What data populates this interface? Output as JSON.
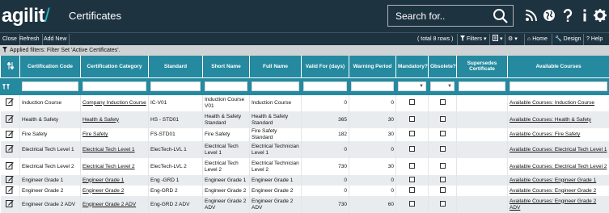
{
  "app": {
    "logo_text": "agilit",
    "logo_slash": "/",
    "page_title": "Certificates",
    "search_placeholder": "Search for.."
  },
  "toolbar": {
    "close": "Close",
    "refresh": "Refresh",
    "add_new": "Add New",
    "total": "( total 8 rows )",
    "filters": "Filters",
    "home": "Home",
    "design": "Design",
    "help": "Help"
  },
  "filter_info": "Applied filters: Filter Set 'Active Certificates'.",
  "table": {
    "headers": [
      "Certification Code",
      "Certification Category",
      "Standard",
      "Short Name",
      "Full Name",
      "Valid For (days)",
      "Warning Period",
      "Mandatory?",
      "Obsolete?",
      "Supersedes Certificate",
      "Available Courses"
    ],
    "rows": [
      {
        "code": "Induction Course",
        "category": "Company Induction Course",
        "standard": "IC-V01",
        "short": "Induction Course V01",
        "full": "Induction Course",
        "valid": "0",
        "warning": "0",
        "courses": "Available Courses: Induction Course"
      },
      {
        "code": "Health & Safety",
        "category": "Health & Safety",
        "standard": "HS - STD01",
        "short": "Health & Safety Standard",
        "full": "Health & Safety Standard",
        "valid": "365",
        "warning": "30",
        "courses": "Available Courses: Health & Safety"
      },
      {
        "code": "Fire Safety",
        "category": "Fire Safety",
        "standard": "FS-STD01",
        "short": "Fire Safety",
        "full": "Fire Safety Standard",
        "valid": "182",
        "warning": "30",
        "courses": "Available Courses: Fire Safety"
      },
      {
        "code": "Electrical Tech Level 1",
        "category": "Electrical Tech Level 1",
        "standard": "ElecTech-LVL 1",
        "short": "Electrical Tech Level 1",
        "full": "Electrical Technician Level 1",
        "valid": "0",
        "warning": "0",
        "courses": "Available Courses: Electrical Tech Level 1"
      },
      {
        "code": "Electrical Tech Level 2",
        "category": "Electrical Tech Level 2",
        "standard": "ElecTech-LVL 2",
        "short": "Electrical Tech Level 2",
        "full": "Electrical Technician Level 2",
        "valid": "730",
        "warning": "30",
        "courses": "Available Courses: Electrical Tech Level 2"
      },
      {
        "code": "Engineer Grade 1",
        "category": "Engineer Grade 1",
        "standard": "Eng -GRD 1",
        "short": "Engineer Grade 1",
        "full": "Engineer Grade 1",
        "valid": "0",
        "warning": "0",
        "courses": "Available Courses: Engineer Grade 1"
      },
      {
        "code": "Engineer Grade 2",
        "category": "Engineer Grade 2",
        "standard": "Eng-GRD 2",
        "short": "Engineer Grade 2",
        "full": "Engineer Grade 2",
        "valid": "0",
        "warning": "0",
        "courses": "Available Courses: Engineer Grade 2"
      },
      {
        "code": "Engineer Grade 2 ADV",
        "category": "Engineer Grade 2 ADV",
        "standard": "Eng-GRD 2 ADV",
        "short": "Engineer Grade 2 ADV",
        "full": "Engineer Grade 2 ADV",
        "valid": "730",
        "warning": "60",
        "courses": "Available Courses: Engineer Grade 2 ADV"
      }
    ]
  }
}
